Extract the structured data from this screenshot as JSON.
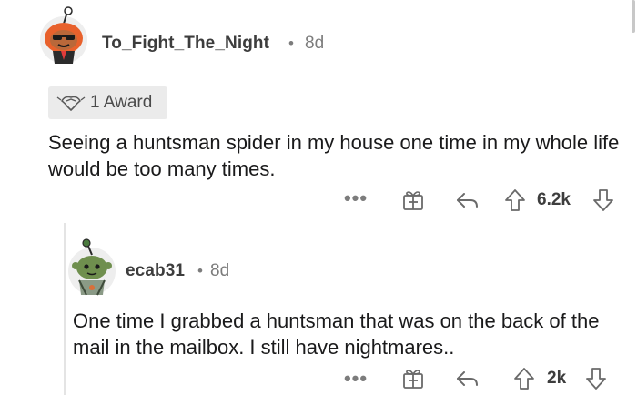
{
  "comments": [
    {
      "username": "To_Fight_The_Night",
      "separator": "•",
      "age": "8d",
      "award": {
        "label": "1 Award"
      },
      "text": "Seeing a huntsman spider in my house one time in my whole life would be too many times.",
      "actions": {
        "more": "•••",
        "votes": "6.2k"
      }
    },
    {
      "username": "ecab31",
      "separator": "•",
      "age": "8d",
      "text": "One time I grabbed a huntsman that was on the back of the mail in the mailbox. I still have nightmares..",
      "actions": {
        "more": "•••",
        "votes": "2k"
      }
    }
  ],
  "colors": {
    "text": "#1a1a1b",
    "meta": "#7c7c7c",
    "icon": "#7c7c7c",
    "award_bg": "#ebebeb"
  }
}
